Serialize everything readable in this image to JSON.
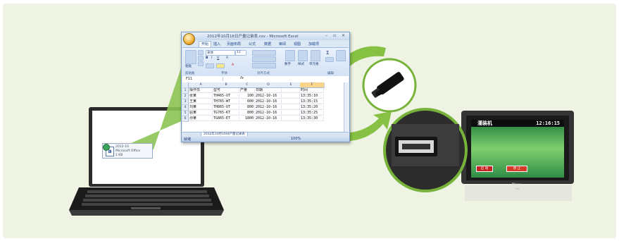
{
  "excel": {
    "title": "2012年10月16日产量记录表.csv - Microsoft Excel",
    "window_controls": "– ▫ ×",
    "tabs": [
      "开始",
      "插入",
      "页面布局",
      "公式",
      "数据",
      "审阅",
      "视图",
      "加载项"
    ],
    "ribbon": {
      "paste_label": "粘贴",
      "font_name": "宋体",
      "font_size": "11",
      "font_format_buttons": [
        "B",
        "I",
        "U",
        "A",
        "A"
      ],
      "number_label": "数字",
      "styles_label": "样式",
      "cells_label": "单元格",
      "sigma": "Σ",
      "groups": [
        "剪贴板",
        "字体",
        "对齐方式",
        "编辑"
      ]
    },
    "name_box": "F11",
    "fx_label": "fx",
    "columns": [
      "A",
      "B",
      "C",
      "D",
      "E",
      "F"
    ],
    "rows": [
      [
        "操作员",
        "型号",
        "产量",
        "日期",
        "",
        "时间"
      ],
      [
        "张某",
        "TH465-UT",
        "100",
        "2012-10-16",
        "",
        "13:35:10"
      ],
      [
        "王某",
        "TH765-WT",
        "600",
        "2012-10-16",
        "",
        "13:35:15"
      ],
      [
        "刘某",
        "TH865-UT",
        "800",
        "2012-10-16",
        "",
        "13:35:20"
      ],
      [
        "屈某",
        "TG765-KT",
        "800",
        "2012-10-16",
        "",
        "13:35:25"
      ],
      [
        "孙某",
        "TG865-ET",
        "1800",
        "2012-10-16",
        "",
        "13:35:30"
      ]
    ],
    "row_numbers": [
      "1",
      "2",
      "3",
      "4",
      "5",
      "6"
    ],
    "sheet_tab": "2012年10月16日产量记录表",
    "status": "就绪",
    "zoom": "100%"
  },
  "laptop_dialog": {
    "icon_letter": "a",
    "line1": "2012-10",
    "line2": "Microsoft Office",
    "line3": "1 KB"
  },
  "hmi": {
    "title": "灌装机",
    "time": "12:16:15",
    "button_left": "启 动",
    "button_mid": "停 止",
    "brand": "Kinco",
    "brand_sub": "HMI"
  },
  "colors": {
    "arrow_green": "#86c144",
    "circle_border": "#77b33a",
    "background": "#eef3e3",
    "excel_selected_col": "#f8d58a"
  }
}
